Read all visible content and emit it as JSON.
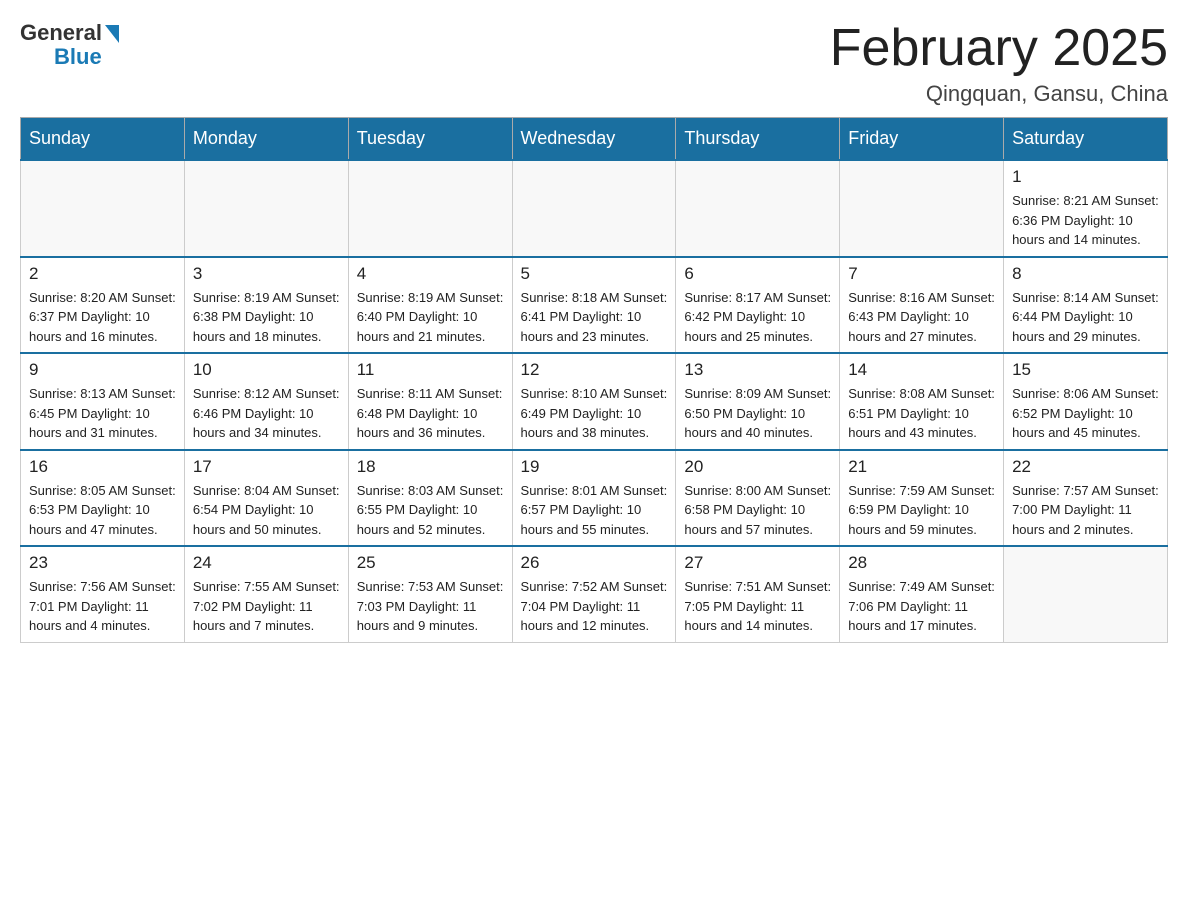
{
  "logo": {
    "general": "General",
    "blue": "Blue"
  },
  "header": {
    "title": "February 2025",
    "location": "Qingquan, Gansu, China"
  },
  "days_of_week": [
    "Sunday",
    "Monday",
    "Tuesday",
    "Wednesday",
    "Thursday",
    "Friday",
    "Saturday"
  ],
  "weeks": [
    [
      {
        "day": "",
        "info": ""
      },
      {
        "day": "",
        "info": ""
      },
      {
        "day": "",
        "info": ""
      },
      {
        "day": "",
        "info": ""
      },
      {
        "day": "",
        "info": ""
      },
      {
        "day": "",
        "info": ""
      },
      {
        "day": "1",
        "info": "Sunrise: 8:21 AM\nSunset: 6:36 PM\nDaylight: 10 hours and 14 minutes."
      }
    ],
    [
      {
        "day": "2",
        "info": "Sunrise: 8:20 AM\nSunset: 6:37 PM\nDaylight: 10 hours and 16 minutes."
      },
      {
        "day": "3",
        "info": "Sunrise: 8:19 AM\nSunset: 6:38 PM\nDaylight: 10 hours and 18 minutes."
      },
      {
        "day": "4",
        "info": "Sunrise: 8:19 AM\nSunset: 6:40 PM\nDaylight: 10 hours and 21 minutes."
      },
      {
        "day": "5",
        "info": "Sunrise: 8:18 AM\nSunset: 6:41 PM\nDaylight: 10 hours and 23 minutes."
      },
      {
        "day": "6",
        "info": "Sunrise: 8:17 AM\nSunset: 6:42 PM\nDaylight: 10 hours and 25 minutes."
      },
      {
        "day": "7",
        "info": "Sunrise: 8:16 AM\nSunset: 6:43 PM\nDaylight: 10 hours and 27 minutes."
      },
      {
        "day": "8",
        "info": "Sunrise: 8:14 AM\nSunset: 6:44 PM\nDaylight: 10 hours and 29 minutes."
      }
    ],
    [
      {
        "day": "9",
        "info": "Sunrise: 8:13 AM\nSunset: 6:45 PM\nDaylight: 10 hours and 31 minutes."
      },
      {
        "day": "10",
        "info": "Sunrise: 8:12 AM\nSunset: 6:46 PM\nDaylight: 10 hours and 34 minutes."
      },
      {
        "day": "11",
        "info": "Sunrise: 8:11 AM\nSunset: 6:48 PM\nDaylight: 10 hours and 36 minutes."
      },
      {
        "day": "12",
        "info": "Sunrise: 8:10 AM\nSunset: 6:49 PM\nDaylight: 10 hours and 38 minutes."
      },
      {
        "day": "13",
        "info": "Sunrise: 8:09 AM\nSunset: 6:50 PM\nDaylight: 10 hours and 40 minutes."
      },
      {
        "day": "14",
        "info": "Sunrise: 8:08 AM\nSunset: 6:51 PM\nDaylight: 10 hours and 43 minutes."
      },
      {
        "day": "15",
        "info": "Sunrise: 8:06 AM\nSunset: 6:52 PM\nDaylight: 10 hours and 45 minutes."
      }
    ],
    [
      {
        "day": "16",
        "info": "Sunrise: 8:05 AM\nSunset: 6:53 PM\nDaylight: 10 hours and 47 minutes."
      },
      {
        "day": "17",
        "info": "Sunrise: 8:04 AM\nSunset: 6:54 PM\nDaylight: 10 hours and 50 minutes."
      },
      {
        "day": "18",
        "info": "Sunrise: 8:03 AM\nSunset: 6:55 PM\nDaylight: 10 hours and 52 minutes."
      },
      {
        "day": "19",
        "info": "Sunrise: 8:01 AM\nSunset: 6:57 PM\nDaylight: 10 hours and 55 minutes."
      },
      {
        "day": "20",
        "info": "Sunrise: 8:00 AM\nSunset: 6:58 PM\nDaylight: 10 hours and 57 minutes."
      },
      {
        "day": "21",
        "info": "Sunrise: 7:59 AM\nSunset: 6:59 PM\nDaylight: 10 hours and 59 minutes."
      },
      {
        "day": "22",
        "info": "Sunrise: 7:57 AM\nSunset: 7:00 PM\nDaylight: 11 hours and 2 minutes."
      }
    ],
    [
      {
        "day": "23",
        "info": "Sunrise: 7:56 AM\nSunset: 7:01 PM\nDaylight: 11 hours and 4 minutes."
      },
      {
        "day": "24",
        "info": "Sunrise: 7:55 AM\nSunset: 7:02 PM\nDaylight: 11 hours and 7 minutes."
      },
      {
        "day": "25",
        "info": "Sunrise: 7:53 AM\nSunset: 7:03 PM\nDaylight: 11 hours and 9 minutes."
      },
      {
        "day": "26",
        "info": "Sunrise: 7:52 AM\nSunset: 7:04 PM\nDaylight: 11 hours and 12 minutes."
      },
      {
        "day": "27",
        "info": "Sunrise: 7:51 AM\nSunset: 7:05 PM\nDaylight: 11 hours and 14 minutes."
      },
      {
        "day": "28",
        "info": "Sunrise: 7:49 AM\nSunset: 7:06 PM\nDaylight: 11 hours and 17 minutes."
      },
      {
        "day": "",
        "info": ""
      }
    ]
  ]
}
